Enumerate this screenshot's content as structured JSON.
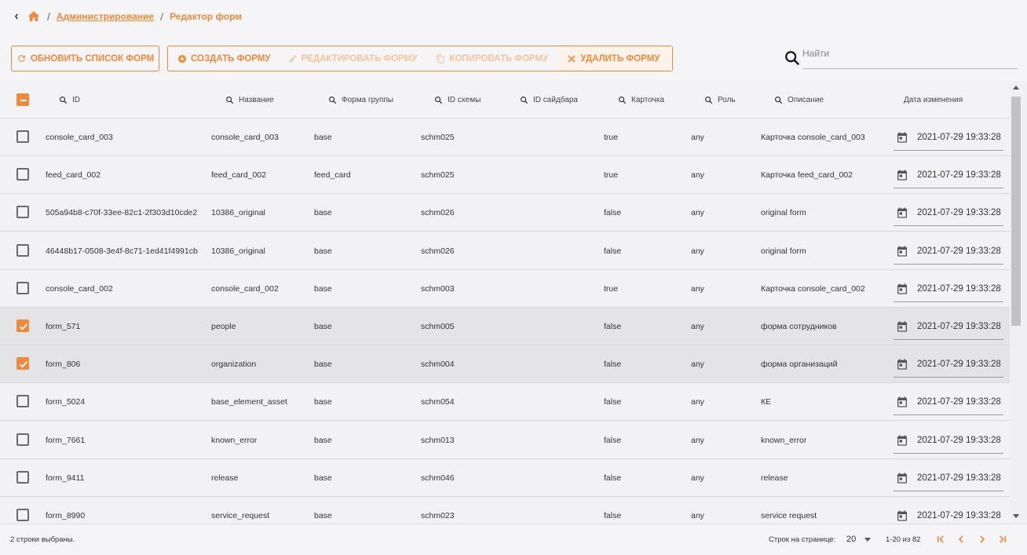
{
  "breadcrumb": {
    "items": [
      {
        "label": "Администрирование"
      },
      {
        "label": "Редактор форм"
      }
    ]
  },
  "toolbar": {
    "refresh_label": "ОБНОВИТЬ СПИСОК ФОРМ",
    "create_label": "СОЗДАТЬ ФОРМУ",
    "edit_label": "РЕДАКТИРОВАТЬ ФОРМУ",
    "copy_label": "КОПИРОВАТЬ ФОРМУ",
    "delete_label": "УДАЛИТЬ ФОРМУ"
  },
  "search": {
    "placeholder": "Найти",
    "value": ""
  },
  "table": {
    "headers": {
      "id": "ID",
      "name": "Название",
      "group_form": "Форма группы",
      "schema_id": "ID схемы",
      "sidebar_id": "ID сайдбара",
      "card": "Карточка",
      "role": "Роль",
      "description": "Описание",
      "modified": "Дата изменения"
    },
    "rows": [
      {
        "selected": false,
        "id": "console_card_003",
        "name": "console_card_003",
        "group_form": "base",
        "schema_id": "schm025",
        "sidebar_id": "",
        "card": "true",
        "role": "any",
        "description": "Карточка console_card_003",
        "modified": "2021-07-29 19:33:28"
      },
      {
        "selected": false,
        "id": "feed_card_002",
        "name": "feed_card_002",
        "group_form": "feed_card",
        "schema_id": "schm025",
        "sidebar_id": "",
        "card": "true",
        "role": "any",
        "description": "Карточка feed_card_002",
        "modified": "2021-07-29 19:33:28"
      },
      {
        "selected": false,
        "id": "505a94b8-c70f-33ee-82c1-2f303d10cde2",
        "name": "10386_original",
        "group_form": "base",
        "schema_id": "schm026",
        "sidebar_id": "",
        "card": "false",
        "role": "any",
        "description": "original form",
        "modified": "2021-07-29 19:33:28"
      },
      {
        "selected": false,
        "id": "46448b17-0508-3e4f-8c71-1ed41f4991cb",
        "name": "10386_original",
        "group_form": "base",
        "schema_id": "schm026",
        "sidebar_id": "",
        "card": "false",
        "role": "any",
        "description": "original form",
        "modified": "2021-07-29 19:33:28"
      },
      {
        "selected": false,
        "id": "console_card_002",
        "name": "console_card_002",
        "group_form": "base",
        "schema_id": "schm003",
        "sidebar_id": "",
        "card": "true",
        "role": "any",
        "description": "Карточка console_card_002",
        "modified": "2021-07-29 19:33:28"
      },
      {
        "selected": true,
        "id": "form_571",
        "name": "people",
        "group_form": "base",
        "schema_id": "schm005",
        "sidebar_id": "",
        "card": "false",
        "role": "any",
        "description": "форма сотрудников",
        "modified": "2021-07-29 19:33:28"
      },
      {
        "selected": true,
        "id": "form_806",
        "name": "organization",
        "group_form": "base",
        "schema_id": "schm004",
        "sidebar_id": "",
        "card": "false",
        "role": "any",
        "description": "форма организаций",
        "modified": "2021-07-29 19:33:28"
      },
      {
        "selected": false,
        "id": "form_5024",
        "name": "base_element_asset",
        "group_form": "base",
        "schema_id": "schm054",
        "sidebar_id": "",
        "card": "false",
        "role": "any",
        "description": "КЕ",
        "modified": "2021-07-29 19:33:28"
      },
      {
        "selected": false,
        "id": "form_7661",
        "name": "known_error",
        "group_form": "base",
        "schema_id": "schm013",
        "sidebar_id": "",
        "card": "false",
        "role": "any",
        "description": "known_error",
        "modified": "2021-07-29 19:33:28"
      },
      {
        "selected": false,
        "id": "form_9411",
        "name": "release",
        "group_form": "base",
        "schema_id": "schm046",
        "sidebar_id": "",
        "card": "false",
        "role": "any",
        "description": "release",
        "modified": "2021-07-29 19:33:28"
      },
      {
        "selected": false,
        "id": "form_8990",
        "name": "service_request",
        "group_form": "base",
        "schema_id": "schm023",
        "sidebar_id": "",
        "card": "false",
        "role": "any",
        "description": "service request",
        "modified": "2021-07-29 19:33:28"
      }
    ]
  },
  "footer": {
    "selected_text": "2 строки выбраны.",
    "rows_per_page_label": "Строк на странице:",
    "rows_per_page": "20",
    "range": "1-20 из 82"
  },
  "colors": {
    "accent": "#f0893a",
    "accent_disabled": "#f6c49c"
  }
}
